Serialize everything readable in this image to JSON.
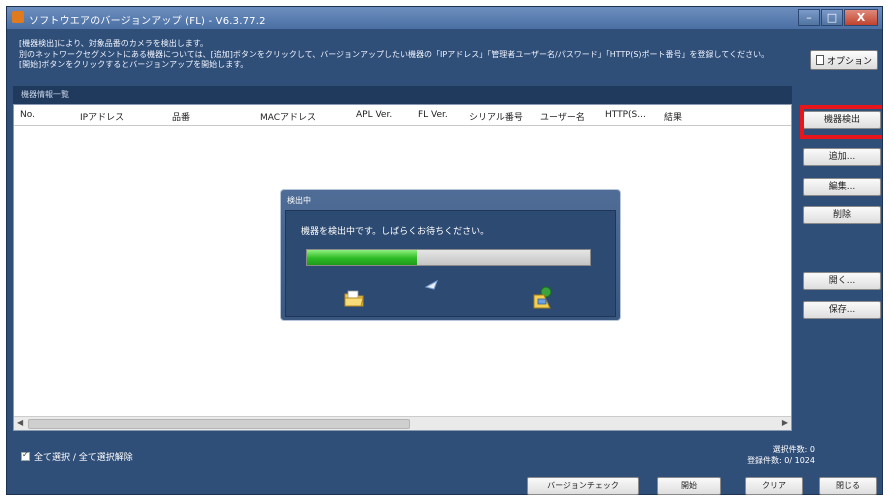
{
  "window": {
    "title": "ソフトウエアのバージョンアップ (FL) - V6.3.77.2",
    "minimize": "–",
    "maximize": "□",
    "close": "X"
  },
  "description": [
    "[機器検出]により、対象品番のカメラを検出します。",
    "別のネットワークセグメントにある機器については、[追加]ボタンをクリックして、バージョンアップしたい機器の「IPアドレス」「管理者ユーザー名/パスワード」「HTTP(S)ポート番号」を登録してください。",
    "[開始]ボタンをクリックするとバージョンアップを開始します。"
  ],
  "options_button": "オプション",
  "section_title": "機器情報一覧",
  "table": {
    "columns": [
      "No.",
      "IPアドレス",
      "品番",
      "MACアドレス",
      "APL Ver.",
      "FL Ver.",
      "シリアル番号",
      "ユーザー名",
      "HTTP(S...",
      "結果"
    ]
  },
  "sidebar": {
    "detect": "機器検出",
    "add": "追加...",
    "edit": "編集...",
    "delete": "削除",
    "open": "開く...",
    "save": "保存..."
  },
  "dialog": {
    "title": "検出中",
    "message": "機器を検出中です。しばらくお待ちください。",
    "progress": 0.39
  },
  "footer": {
    "select_all": "全て選択 / 全て選択解除",
    "selected_count": "選択件数: 0",
    "registered_count": "登録件数:  0/ 1024"
  },
  "bottom_buttons": {
    "version_check": "バージョンチェック",
    "start": "開始",
    "clear": "クリア",
    "close": "閉じる"
  },
  "colors": {
    "window_bg": "#2f4e78",
    "highlight": "#e8161a",
    "progress_fill": "#2dbb25"
  }
}
